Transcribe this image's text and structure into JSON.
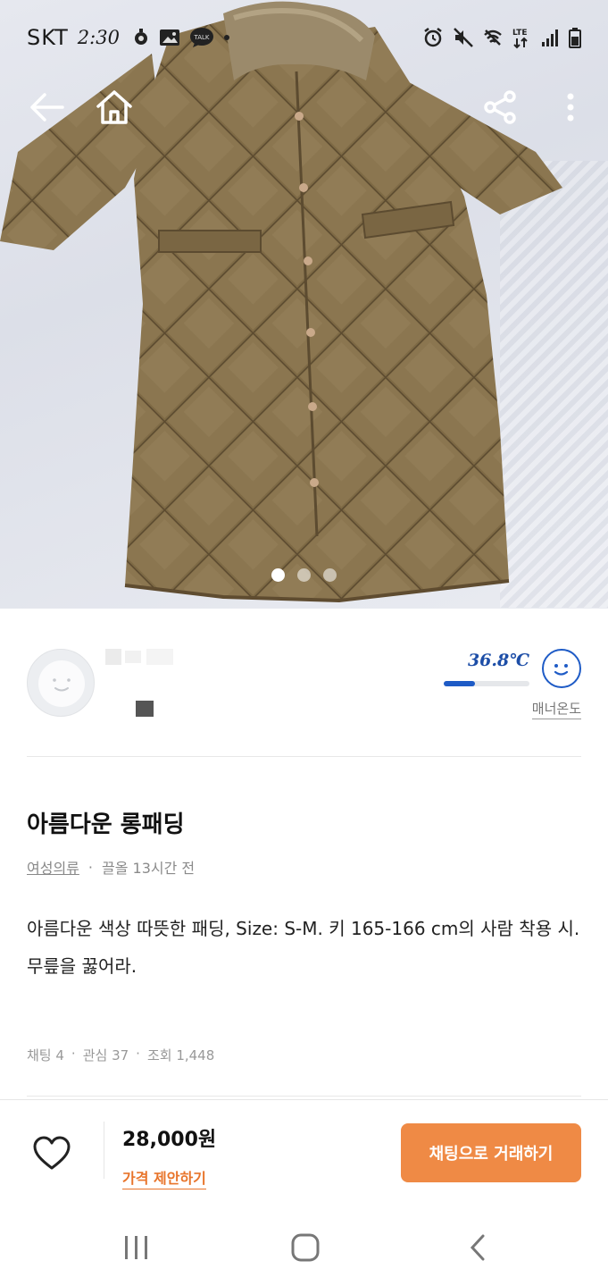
{
  "status_bar": {
    "carrier": "SKT",
    "time": "2:30",
    "network": "LTE"
  },
  "hero": {
    "icons": [
      "back-arrow-icon",
      "home-icon",
      "share-icon",
      "more-vertical-icon"
    ],
    "image_count": 3,
    "active_index": 0
  },
  "seller": {
    "manner_temp": "36.8℃",
    "manner_temp_level": 0.368,
    "manner_label": "매너온도"
  },
  "item": {
    "title": "아름다운 롱패딩",
    "category": "여성의류",
    "time": "끌올 13시간 전",
    "description": "아름다운 색상 따뜻한 패딩, Size: S-M. 키 165-166 cm의 사람 착용 시.  무릎을 꿇어라.",
    "stats": {
      "chat": "채팅 4",
      "interest": "관심 37",
      "views": "조회 1,448"
    }
  },
  "action_bar": {
    "price": "28,000원",
    "offer_label": "가격 제안하기",
    "chat_button": "채팅으로 거래하기"
  },
  "colors": {
    "accent": "#ef8a45",
    "temp_blue": "#1e5bc6"
  }
}
